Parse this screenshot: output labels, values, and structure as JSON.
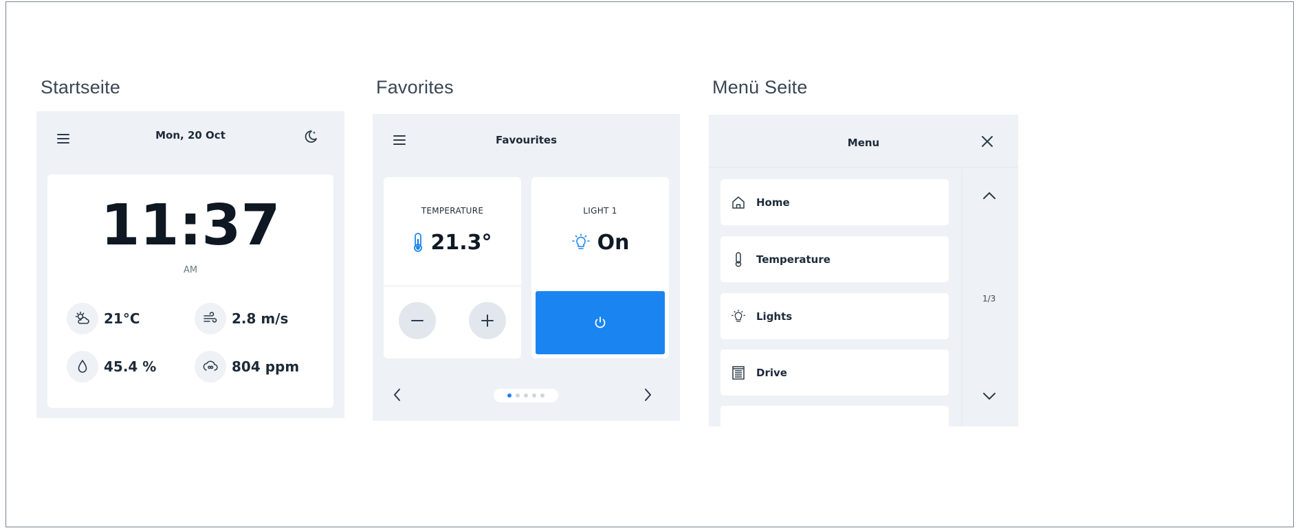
{
  "sections": {
    "start_title": "Startseite",
    "fav_title": "Favorites",
    "menu_title": "Menü Seite"
  },
  "start": {
    "date": "Mon, 20 Oct",
    "time": "11:37",
    "ampm": "AM",
    "metrics": {
      "temperature": "21°C",
      "wind": "2.8 m/s",
      "humidity": "45.4 %",
      "co2": "804 ppm"
    }
  },
  "favorites": {
    "header": "Favourites",
    "temp_label": "TEMPERATURE",
    "temp_value": "21.3°",
    "light_label": "LIGHT 1",
    "light_value": "On",
    "page_dots": 5,
    "active_dot": 1
  },
  "menu": {
    "header": "Menu",
    "items": [
      {
        "label": "Home",
        "icon": "home-icon"
      },
      {
        "label": "Temperature",
        "icon": "thermometer-icon"
      },
      {
        "label": "Lights",
        "icon": "bulb-icon"
      },
      {
        "label": "Drive",
        "icon": "blinds-icon"
      }
    ],
    "pager": "1/3"
  },
  "colors": {
    "accent": "#1a85f0",
    "panel_bg": "#eef1f6",
    "text": "#1d2a38"
  }
}
